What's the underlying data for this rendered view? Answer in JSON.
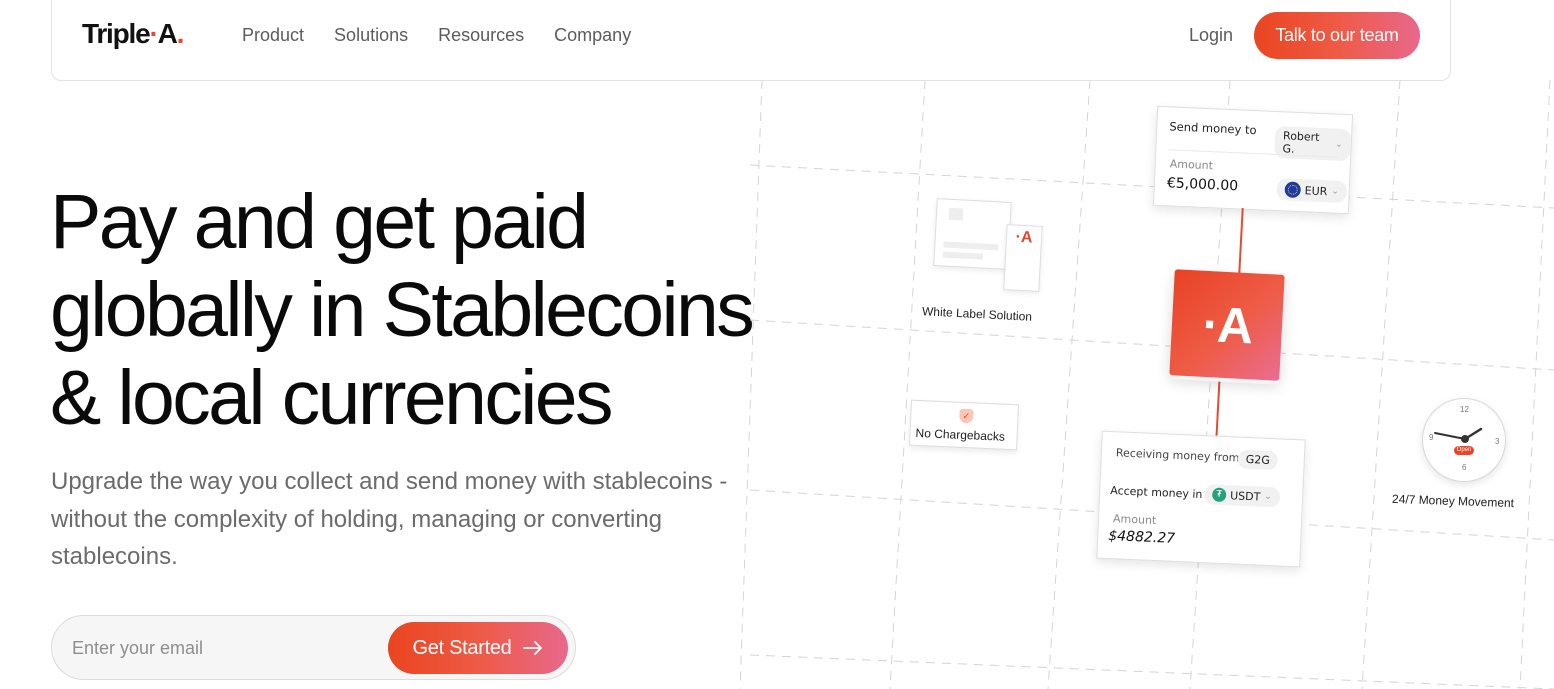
{
  "nav": {
    "logo": "Triple",
    "logo_dot": "·",
    "logo_suffix": "A",
    "logo_end": ".",
    "links": [
      "Product",
      "Solutions",
      "Resources",
      "Company"
    ],
    "login": "Login",
    "cta": "Talk to our team"
  },
  "hero": {
    "title_line1": "Pay and get paid",
    "title_line2": "globally in Stablecoins",
    "title_line3": "& local currencies",
    "subtitle": "Upgrade the way you collect and send money with stablecoins - without the complexity of holding, managing or converting stablecoins.",
    "email_placeholder": "Enter your email",
    "cta": "Get Started",
    "cta_icon": "arrow-right-icon"
  },
  "illustration": {
    "send_card": {
      "label": "Send money to",
      "recipient": "Robert G.",
      "amount_label": "Amount",
      "amount": "€5,000.00",
      "currency": "EUR",
      "currency_icon": "eu-flag-icon"
    },
    "center_logo": "·A",
    "white_label": {
      "label": "White Label Solution",
      "doc_logo": "·A"
    },
    "no_chargebacks": {
      "label": "No Chargebacks",
      "icon": "shield-icon"
    },
    "receive_card": {
      "receiving_label": "Receiving money from",
      "receiving_from": "G2G",
      "accept_label": "Accept money in",
      "accept_currency": "USDT",
      "accept_icon": "tether-icon",
      "amount_label": "Amount",
      "amount": "$4882.27"
    },
    "clock": {
      "label": "24/7 Money Movement",
      "n12": "12",
      "n3": "3",
      "n6": "6",
      "n9": "9",
      "badge": "Open"
    }
  },
  "colors": {
    "accent_start": "#ea4520",
    "accent_end": "#e8688c",
    "text_dark": "#0a0a0a",
    "text_muted": "#6b6b6b"
  }
}
